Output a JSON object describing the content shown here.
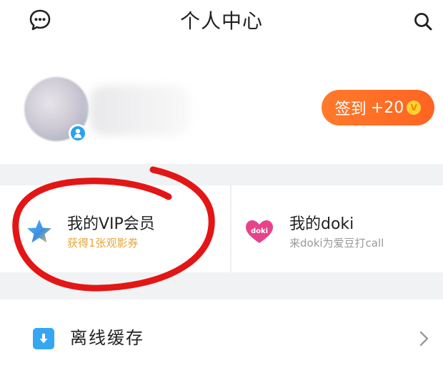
{
  "header": {
    "title": "个人中心",
    "left_icon": "message-bubble-icon",
    "right_icon": "search-icon"
  },
  "profile": {
    "avatar_icon": "avatar",
    "badge_icon": "person-badge-icon",
    "checkin": {
      "label": "签到",
      "reward": "+20",
      "coin_symbol": "V"
    }
  },
  "cards": [
    {
      "title": "我的VIP会员",
      "subtitle": "获得1张观影券",
      "icon": "vip-star-icon",
      "subtitle_color": "#e6a63b"
    },
    {
      "title": "我的doki",
      "subtitle": "来doki为爱豆打call",
      "icon": "doki-heart-icon",
      "icon_text": "doki",
      "subtitle_color": "#999999"
    }
  ],
  "list": {
    "items": [
      {
        "label": "离线缓存",
        "icon": "download-icon"
      }
    ]
  },
  "colors": {
    "accent_orange": "#ff6a25",
    "annotation_red": "#e31515",
    "blue": "#36a6f3",
    "doki_pink": "#e6448a"
  }
}
